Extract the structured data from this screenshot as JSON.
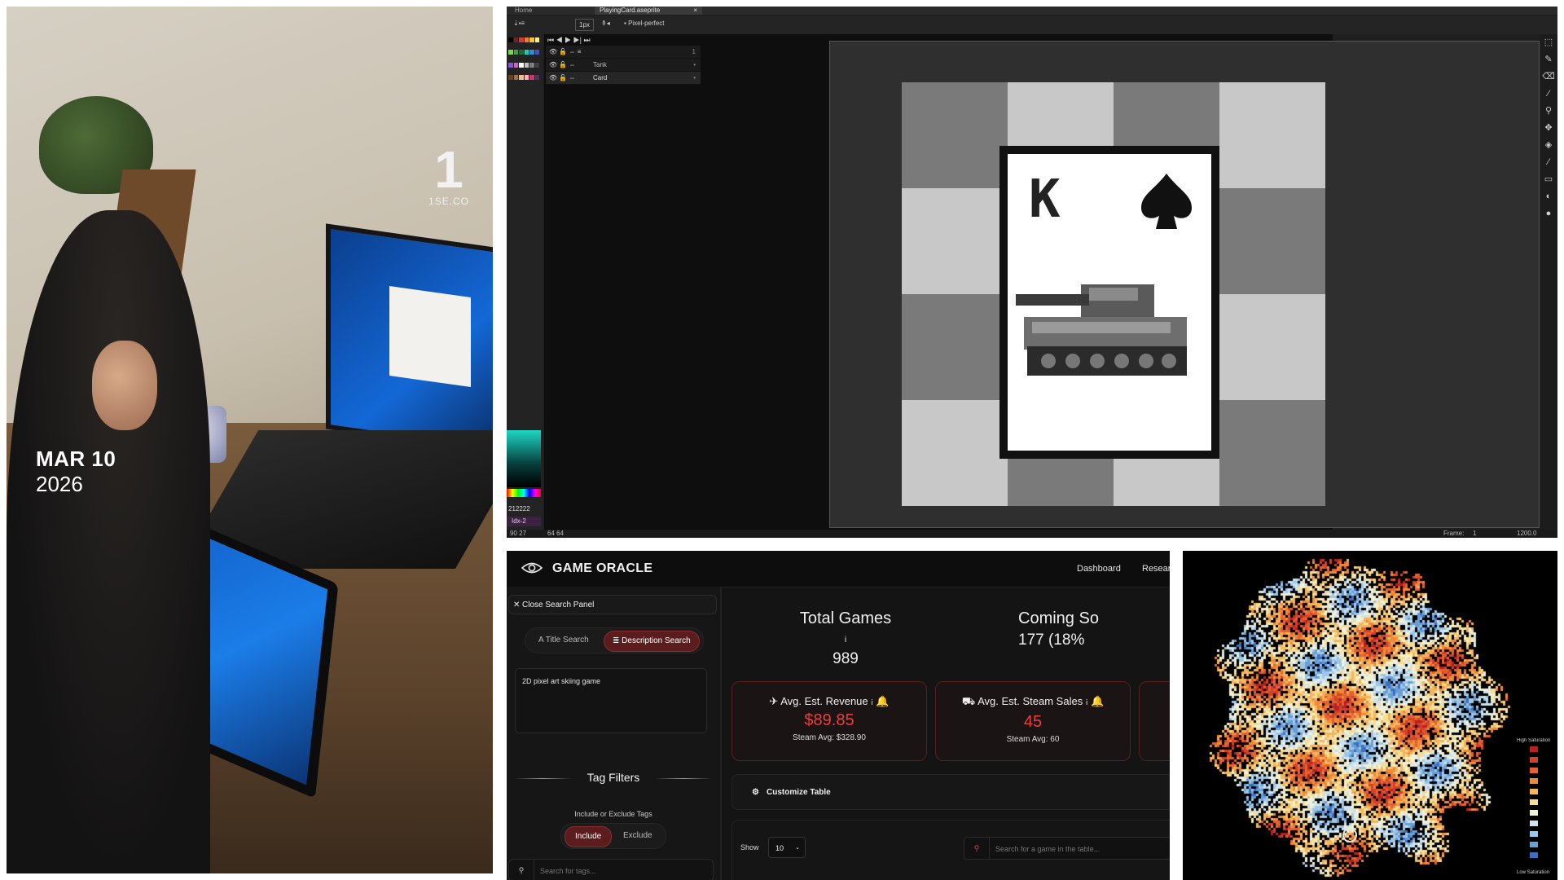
{
  "photo": {
    "date_line1": "MAR 10",
    "date_line2": "2026",
    "watermark_text": "1SE.CO"
  },
  "aseprite": {
    "tabs": [
      "Home",
      "PlayingCard.aseprite"
    ],
    "toolbar": {
      "brush_size": "1px",
      "pixel_perfect_label": "Pixel-perfect"
    },
    "layers": [
      {
        "name": "",
        "dot": "1"
      },
      {
        "name": "Tank",
        "dot": "•"
      },
      {
        "name": "Card",
        "dot": "•"
      }
    ],
    "color_hex": "212222",
    "index_label": "Idx-2",
    "card_rank": "K",
    "status": {
      "pos": "90 27",
      "size": "64 64",
      "frame_label": "Frame:",
      "frame_value": "1",
      "zoom": "1200.0"
    },
    "checker_colors": [
      "#7a7a7a",
      "#c8c8c8"
    ],
    "palette": [
      "#000000",
      "#7d1c1c",
      "#d13b3b",
      "#e7832e",
      "#f3c13a",
      "#fff06b",
      "#7ad64b",
      "#3fa33c",
      "#1f6b3a",
      "#2dc5b0",
      "#2c8fd6",
      "#3a4fd1",
      "#8a54d6",
      "#d45ad6",
      "#ffffff",
      "#bfbfbf",
      "#7f7f7f",
      "#404040",
      "#6b3f1f",
      "#a9703a",
      "#f0c08a",
      "#ffb0c0",
      "#c83a6a",
      "#5a2a6a"
    ]
  },
  "oracle": {
    "brand": "GAME ORACLE",
    "nav": [
      "Dashboard",
      "Resear"
    ],
    "close_panel": "Close Search Panel",
    "search_modes": [
      "Title Search",
      "Description Search"
    ],
    "description_value": "2D pixel art skiing game",
    "tag_filters_title": "Tag Filters",
    "include_exclude_label": "Include or Exclude Tags",
    "include_label": "Include",
    "exclude_label": "Exclude",
    "tag_search_placeholder": "Search for tags...",
    "stats": [
      {
        "title": "Total Games",
        "value": "989"
      },
      {
        "title": "Coming So",
        "value": "177 (18%"
      }
    ],
    "kpis": [
      {
        "title": "Avg. Est. Revenue",
        "value": "$89.85",
        "sub": "Steam Avg: $328.90"
      },
      {
        "title": "Avg. Est. Steam Sales",
        "value": "45",
        "sub": "Steam Avg: 60"
      }
    ],
    "customize_label": "Customize Table",
    "show_label": "Show",
    "show_value": "10",
    "game_search_placeholder": "Search for a game in the table...",
    "accent": "#ef3d3d"
  },
  "heatmap": {
    "legend_high": "High Saturation",
    "legend_low": "Low Saturation",
    "legend_colors": [
      "#b8211e",
      "#d2412b",
      "#e4622f",
      "#ef8a3a",
      "#f4b55c",
      "#f7dc94",
      "#f1f1d8",
      "#cfe3ef",
      "#9ec7e6",
      "#6a9fd6",
      "#3e6fbf"
    ]
  }
}
